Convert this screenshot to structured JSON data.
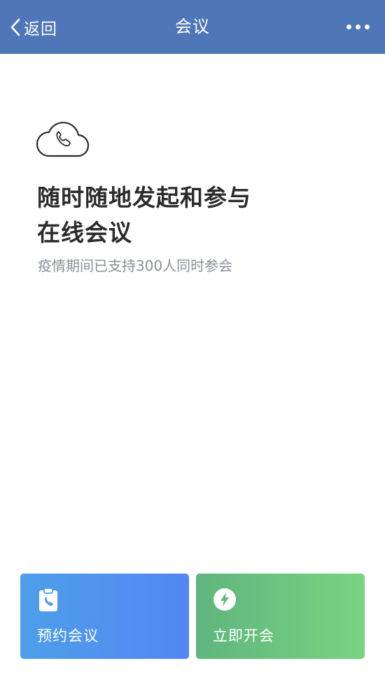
{
  "navbar": {
    "back_label": "返回",
    "title": "会议",
    "more_icon": "more-dots-icon",
    "background": "#4f76b7"
  },
  "hero": {
    "icon": "cloud-phone-icon",
    "title_line1": "随时随地发起和参与",
    "title_line2": "在线会议",
    "subtitle": "疫情期间已支持300人同时参会"
  },
  "actions": [
    {
      "label": "预约会议",
      "icon": "clipboard-phone-icon",
      "color_start": "#4e9ee9",
      "color_end": "#5387f4"
    },
    {
      "label": "立即开会",
      "icon": "lightning-icon",
      "color_start": "#5fb57e",
      "color_end": "#78d481"
    }
  ]
}
